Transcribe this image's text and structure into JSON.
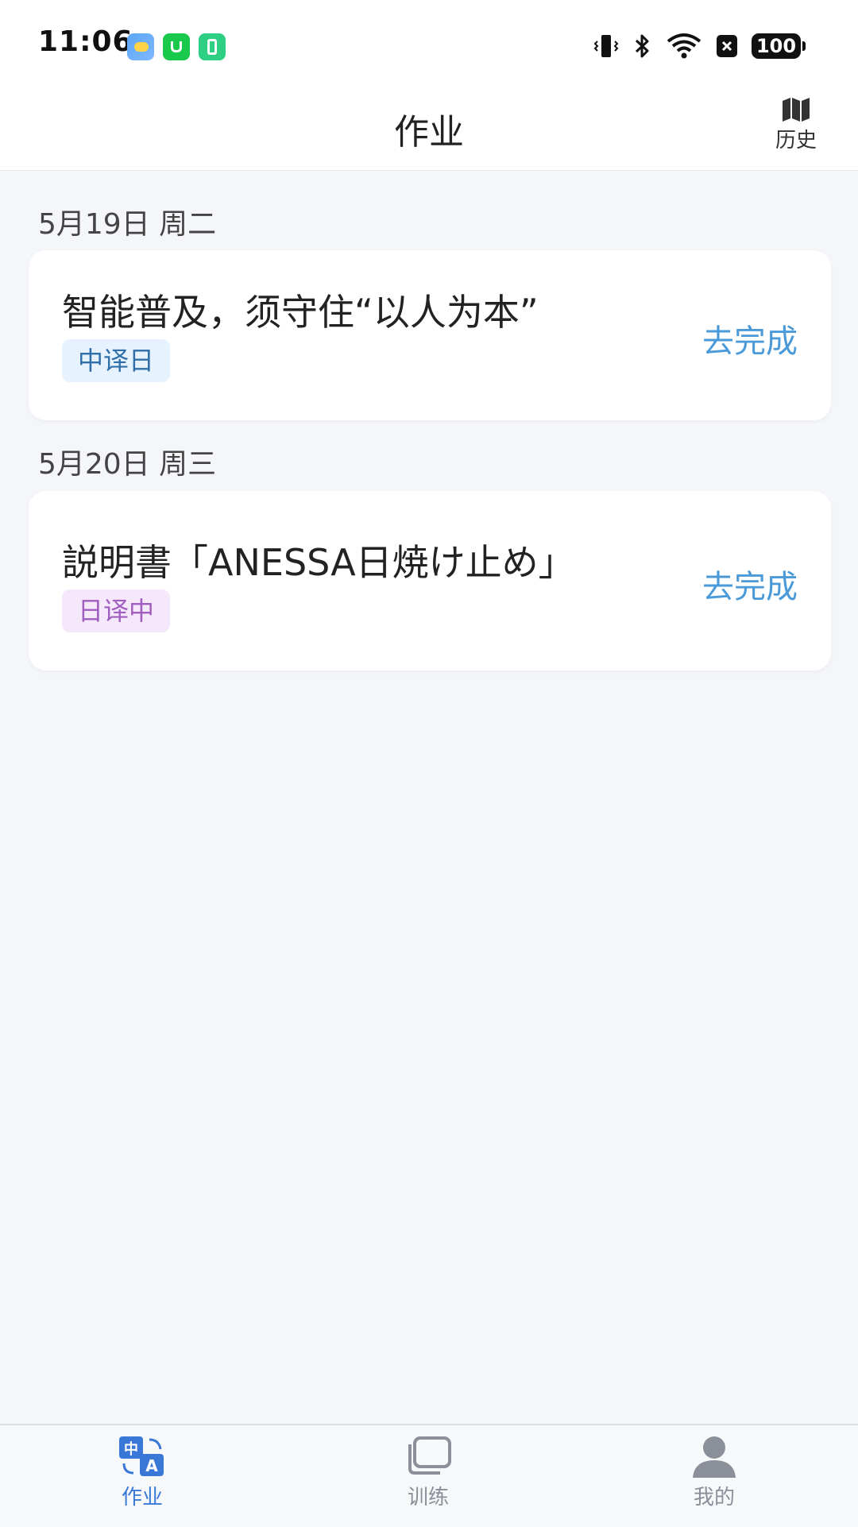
{
  "status_bar": {
    "time": "11:06",
    "battery": "100"
  },
  "header": {
    "title": "作业",
    "history_label": "历史"
  },
  "sections": [
    {
      "date": "5月19日 周二",
      "title": "智能普及，须守住“以人为本”",
      "tag": "中译日",
      "action": "去完成"
    },
    {
      "date": "5月20日 周三",
      "title": "説明書「ANESSA日焼け止め」",
      "tag": "日译中",
      "action": "去完成"
    }
  ],
  "tab_bar": {
    "tabs": [
      {
        "label": "作业",
        "icon": "translate-icon",
        "active": true
      },
      {
        "label": "训练",
        "icon": "cards-icon",
        "active": false
      },
      {
        "label": "我的",
        "icon": "user-icon",
        "active": false
      }
    ]
  },
  "colors": {
    "accent": "#4a9ad9",
    "tab_active": "#3a78d8",
    "tag_zh_ja_bg": "#e6f2fd",
    "tag_ja_zh_bg": "#f6e8fb"
  }
}
